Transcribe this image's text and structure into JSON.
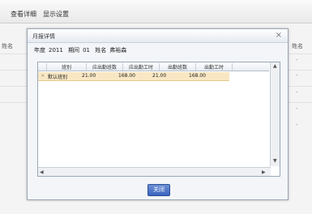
{
  "menubar": {
    "view_details": "查看详细",
    "display_settings": "显示设置"
  },
  "background": {
    "name_header": "姓名",
    "name_header_right": "姓名",
    "dash": "-"
  },
  "dialog": {
    "title": "月报详情",
    "close_icon": "×",
    "info": {
      "year_label": "年度",
      "year": "2011",
      "period_label": "期间",
      "period": "01",
      "name_label": "姓名",
      "name": "弗裕森"
    },
    "grid": {
      "columns": [
        "班别",
        "应出勤班数",
        "应出勤工时",
        "出勤班数",
        "出勤工时"
      ],
      "rows": [
        {
          "marker": "»",
          "cells": [
            "默认班别",
            "21.00",
            "168.00",
            "21.00",
            "168.00"
          ]
        }
      ]
    },
    "close_button": "关闭"
  }
}
